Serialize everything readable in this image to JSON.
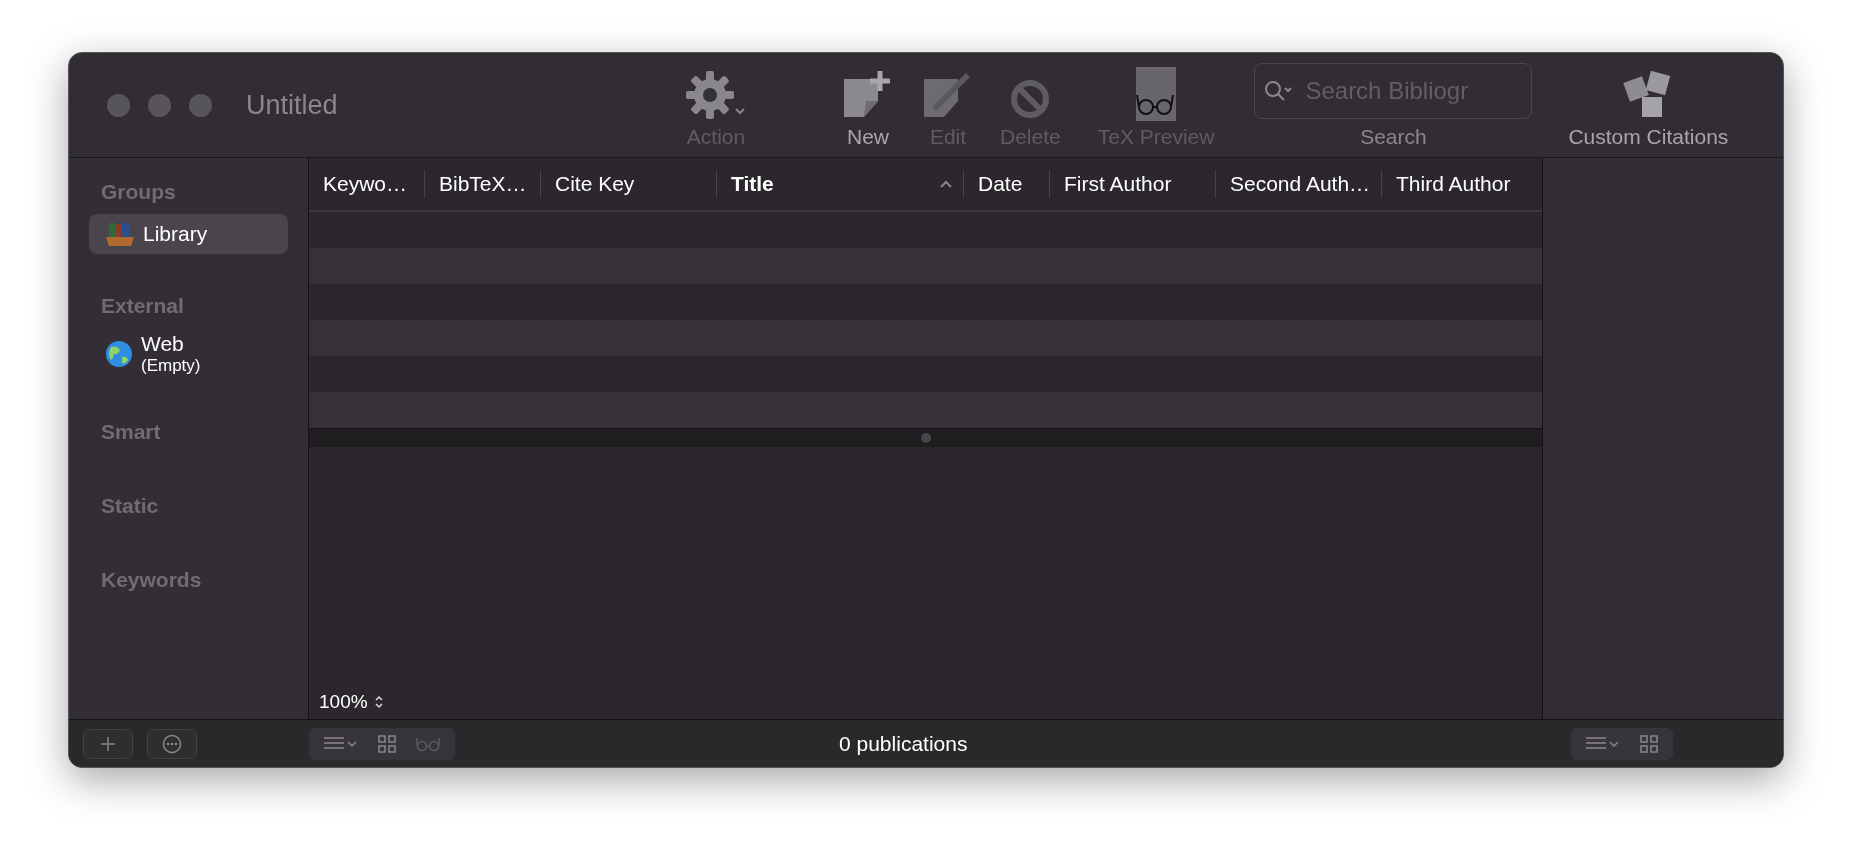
{
  "window": {
    "title": "Untitled",
    "active": false
  },
  "toolbar": [
    {
      "kind": "action",
      "label": "Action",
      "disabled": true
    },
    {
      "kind": "new",
      "label": "New",
      "disabled": false
    },
    {
      "kind": "edit",
      "label": "Edit",
      "disabled": true
    },
    {
      "kind": "delete",
      "label": "Delete",
      "disabled": true
    },
    {
      "kind": "tex",
      "label": "TeX Preview",
      "disabled": true
    },
    {
      "kind": "search",
      "label": "Search",
      "placeholder": "Search Bibliogr"
    },
    {
      "kind": "citations",
      "label": "Custom Citations",
      "disabled": false
    }
  ],
  "sidebar": [
    {
      "title": "Groups",
      "items": [
        {
          "kind": "library",
          "label": "Library",
          "selected": true
        }
      ]
    },
    {
      "title": "External",
      "items": [
        {
          "kind": "web",
          "label": "Web",
          "detail": "(Empty)",
          "selected": false
        }
      ]
    },
    {
      "title": "Smart"
    },
    {
      "title": "Static"
    },
    {
      "title": "Keywords"
    }
  ],
  "table": {
    "columns": [
      {
        "label": "Keywo…",
        "sorted": false
      },
      {
        "label": "BibTeX…",
        "sorted": false
      },
      {
        "label": "Cite Key",
        "sorted": false
      },
      {
        "label": "Title",
        "sorted": true
      },
      {
        "label": "Date",
        "sorted": false
      },
      {
        "label": "First Author",
        "sorted": false
      },
      {
        "label": "Second Auth…",
        "sorted": false
      },
      {
        "label": "Third Author",
        "sorted": false
      }
    ]
  },
  "zoom": "100%",
  "status_bar": "0 publications"
}
